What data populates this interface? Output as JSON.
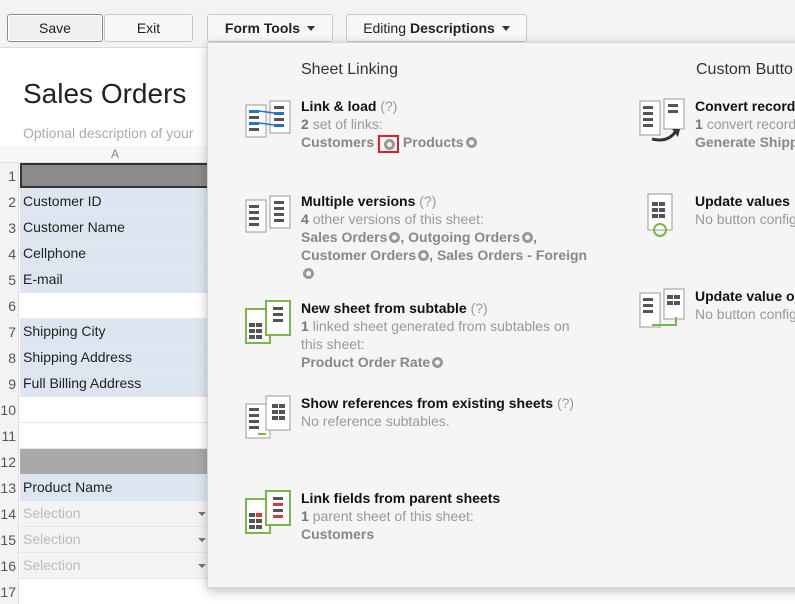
{
  "toolbar": {
    "save": "Save",
    "exit": "Exit",
    "form_tools": "Form Tools",
    "editing_prefix": "Editing",
    "editing_mode": "Descriptions"
  },
  "sheet": {
    "title": "Sales Orders",
    "description_placeholder": "Optional description of your",
    "column_header": "A",
    "rows": [
      {
        "num": "1",
        "text": "",
        "kind": "dark"
      },
      {
        "num": "2",
        "text": "Customer ID",
        "kind": "field"
      },
      {
        "num": "3",
        "text": "Customer Name",
        "kind": "field"
      },
      {
        "num": "4",
        "text": "Cellphone",
        "kind": "field"
      },
      {
        "num": "5",
        "text": "E-mail",
        "kind": "field"
      },
      {
        "num": "6",
        "text": "",
        "kind": "empty"
      },
      {
        "num": "7",
        "text": "Shipping City",
        "kind": "field"
      },
      {
        "num": "8",
        "text": "Shipping Address",
        "kind": "field"
      },
      {
        "num": "9",
        "text": "Full Billing Address",
        "kind": "field"
      },
      {
        "num": "10",
        "text": "",
        "kind": "empty"
      },
      {
        "num": "11",
        "text": "",
        "kind": "empty"
      },
      {
        "num": "12",
        "text": "",
        "kind": "medium"
      },
      {
        "num": "13",
        "text": "Product Name",
        "kind": "field"
      },
      {
        "num": "14",
        "text": "Selection",
        "kind": "select"
      },
      {
        "num": "15",
        "text": "Selection",
        "kind": "select"
      },
      {
        "num": "16",
        "text": "Selection",
        "kind": "select"
      },
      {
        "num": "17",
        "text": "",
        "kind": "empty"
      }
    ]
  },
  "panel": {
    "sheet_linking_title": "Sheet Linking",
    "custom_buttons_title": "Custom Butto",
    "link_load": {
      "title": "Link & load",
      "help": "(?)",
      "count": "2",
      "count_text": "set of links:",
      "link1": "Customers",
      "link2": "Products"
    },
    "multiple_versions": {
      "title": "Multiple versions",
      "help": "(?)",
      "count": "4",
      "count_text": "other versions of this sheet:",
      "v1": "Sales Orders",
      "v2": "Outgoing Orders",
      "v3": "Customer Orders",
      "v4": "Sales Orders - Foreign"
    },
    "new_sheet_subtable": {
      "title": "New sheet from subtable",
      "help": "(?)",
      "count": "1",
      "count_text": "linked sheet generated from subtables on",
      "line2": "this sheet:",
      "link1": "Product Order Rate"
    },
    "show_references": {
      "title": "Show references from existing sheets",
      "help": "(?)",
      "desc": "No reference subtables."
    },
    "link_fields_parent": {
      "title": "Link fields from parent sheets",
      "count": "1",
      "count_text": "parent sheet of this sheet:",
      "link1": "Customers"
    },
    "convert_records": {
      "title": "Convert records",
      "count": "1",
      "count_text": "convert records",
      "link1": "Generate Shipp"
    },
    "update_values": {
      "title": "Update values",
      "desc": "No button configu"
    },
    "update_value_other": {
      "title": "Update value o",
      "desc": "No button configu"
    }
  },
  "colors": {
    "field_bg": "#dde6f0",
    "dark_row": "#8c8c8c",
    "icon_blue": "#2a6fc0",
    "icon_green": "#7ab648",
    "icon_red": "#d23a3a",
    "highlight_red": "#e02020"
  }
}
